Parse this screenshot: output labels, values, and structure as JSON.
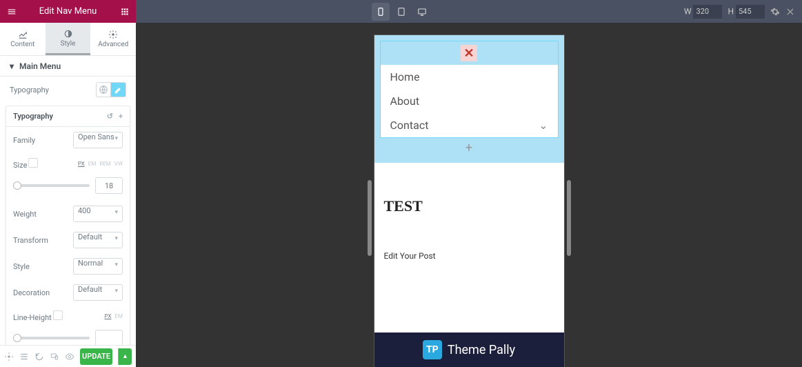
{
  "header": {
    "title": "Edit Nav Menu"
  },
  "responsive": {
    "w_label": "W",
    "w": "320",
    "h_label": "H",
    "h": "545"
  },
  "tabs": {
    "content": "Content",
    "style": "Style",
    "advanced": "Advanced"
  },
  "section": {
    "main_menu": "Main Menu"
  },
  "typo_row": {
    "label": "Typography"
  },
  "popover": {
    "title": "Typography",
    "family": {
      "label": "Family",
      "value": "Open Sans"
    },
    "size": {
      "label": "Size",
      "units": [
        "PX",
        "EM",
        "REM",
        "VW"
      ],
      "value": "18"
    },
    "weight": {
      "label": "Weight",
      "value": "400"
    },
    "transform": {
      "label": "Transform",
      "value": "Default"
    },
    "style": {
      "label": "Style",
      "value": "Normal"
    },
    "decoration": {
      "label": "Decoration",
      "value": "Default"
    },
    "line_height": {
      "label": "Line-Height",
      "units": [
        "PX",
        "EM"
      ],
      "value": ""
    }
  },
  "footer": {
    "update": "UPDATE"
  },
  "preview": {
    "menu": [
      "Home",
      "About",
      "Contact"
    ],
    "heading": "TEST",
    "edit_post": "Edit Your Post",
    "brand": "Theme Pally",
    "brand_short": "TP"
  }
}
